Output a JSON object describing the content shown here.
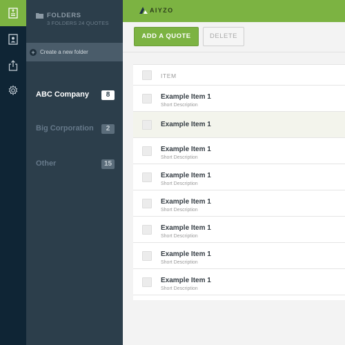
{
  "rail": {
    "items": [
      {
        "icon": "document-icon",
        "active": true
      },
      {
        "icon": "contact-card-icon",
        "active": false
      },
      {
        "icon": "share-export-icon",
        "active": false
      },
      {
        "icon": "gear-icon",
        "active": false
      }
    ],
    "accent": "#7cb342",
    "background": "#0f2535"
  },
  "folders": {
    "title": "FOLDERS",
    "subtitle": "3 FOLDERS 24 QUOTES",
    "create_label": "Create a new folder",
    "items": [
      {
        "name": "ABC Company",
        "count": "8",
        "active": true
      },
      {
        "name": "Big Corporation",
        "count": "2",
        "active": false
      },
      {
        "name": "Other",
        "count": "15",
        "active": false
      }
    ]
  },
  "header": {
    "logo_text": "AIYZO",
    "brand_color": "#7cb342"
  },
  "toolbar": {
    "add_label": "ADD A QUOTE",
    "delete_label": "DELETE"
  },
  "table": {
    "column_header": "ITEM",
    "rows": [
      {
        "title": "Example Item 1",
        "description": "Short Description",
        "hover": false
      },
      {
        "title": "Example Item 1",
        "description": "",
        "hover": true
      },
      {
        "title": "Example Item 1",
        "description": "Short Description",
        "hover": false
      },
      {
        "title": "Example Item 1",
        "description": "Short Description",
        "hover": false
      },
      {
        "title": "Example Item 1",
        "description": "Short Description",
        "hover": false
      },
      {
        "title": "Example Item 1",
        "description": "Short Description",
        "hover": false
      },
      {
        "title": "Example Item 1",
        "description": "Short Description",
        "hover": false
      },
      {
        "title": "Example Item 1",
        "description": "Short Description",
        "hover": false
      }
    ]
  }
}
